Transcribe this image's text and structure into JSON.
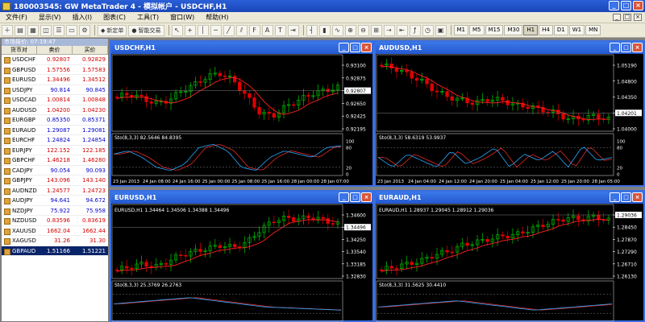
{
  "window": {
    "title": "180003545: GW MetaTrader 4 - 模拟帐户 - USDCHF,H1",
    "min": "_",
    "max": "□",
    "close": "×"
  },
  "menu": {
    "items": [
      "文件(F)",
      "显示(V)",
      "插入(I)",
      "图表(C)",
      "工具(T)",
      "窗口(W)",
      "帮助(H)"
    ],
    "mdi": [
      "_",
      "□",
      "×"
    ]
  },
  "toolbar": {
    "new_order": "新定单",
    "auto_trading": "智能交易",
    "timeframes": [
      "M1",
      "M5",
      "M15",
      "M30",
      "H1",
      "H4",
      "D1",
      "W1",
      "MN"
    ],
    "active_timeframe": "H1"
  },
  "market_watch": {
    "title": "市场报价: 07:19:47",
    "headers": [
      "货币对",
      "卖价",
      "买价"
    ],
    "rows": [
      {
        "symbol": "USDCHF",
        "bid": "0.92807",
        "ask": "0.92829",
        "dir": "down"
      },
      {
        "symbol": "GBPUSD",
        "bid": "1.57556",
        "ask": "1.57583",
        "dir": "down"
      },
      {
        "symbol": "EURUSD",
        "bid": "1.34496",
        "ask": "1.34512",
        "dir": "down"
      },
      {
        "symbol": "USDJPY",
        "bid": "90.814",
        "ask": "90.845",
        "dir": "up"
      },
      {
        "symbol": "USDCAD",
        "bid": "1.00814",
        "ask": "1.00848",
        "dir": "down"
      },
      {
        "symbol": "AUDUSD",
        "bid": "1.04200",
        "ask": "1.04230",
        "dir": "down"
      },
      {
        "symbol": "EURGBP",
        "bid": "0.85350",
        "ask": "0.85371",
        "dir": "up"
      },
      {
        "symbol": "EURAUD",
        "bid": "1.29087",
        "ask": "1.29081",
        "dir": "up"
      },
      {
        "symbol": "EURCHF",
        "bid": "1.24824",
        "ask": "1.24854",
        "dir": "up"
      },
      {
        "symbol": "EURJPY",
        "bid": "122.152",
        "ask": "122.185",
        "dir": "down"
      },
      {
        "symbol": "GBPCHF",
        "bid": "1.46218",
        "ask": "1.46280",
        "dir": "down"
      },
      {
        "symbol": "CADJPY",
        "bid": "90.054",
        "ask": "90.093",
        "dir": "up"
      },
      {
        "symbol": "GBPJPY",
        "bid": "143.096",
        "ask": "143.140",
        "dir": "down"
      },
      {
        "symbol": "AUDNZD",
        "bid": "1.24577",
        "ask": "1.24723",
        "dir": "down"
      },
      {
        "symbol": "AUDJPY",
        "bid": "94.641",
        "ask": "94.672",
        "dir": "up"
      },
      {
        "symbol": "NZDJPY",
        "bid": "75.922",
        "ask": "75.958",
        "dir": "up"
      },
      {
        "symbol": "NZDUSD",
        "bid": "0.83596",
        "ask": "0.83619",
        "dir": "down"
      },
      {
        "symbol": "XAUUSD",
        "bid": "1662.04",
        "ask": "1662.44",
        "dir": "down"
      },
      {
        "symbol": "XAGUSD",
        "bid": "31.26",
        "ask": "31.30",
        "dir": "down"
      },
      {
        "symbol": "GBPAUD",
        "bid": "1.51166",
        "ask": "1.51221",
        "dir": "sel"
      }
    ]
  },
  "colors": {
    "bull": "#00c800",
    "bear": "#e00000",
    "ma": "#ff2020",
    "stoch_main": "#2aa8ff",
    "stoch_signal": "#ff3030",
    "grid": "#404040",
    "axis_text": "#ffffff",
    "price_line": "#808080"
  },
  "charts": [
    {
      "title": "USDCHF,H1",
      "prices": [
        "0.93100",
        "0.92875",
        "0.92807",
        "0.92650",
        "0.92425",
        "0.92195"
      ],
      "current": "0.92807",
      "stoch_label": "Sto(8,3,3) 82.5646 84.8395",
      "stoch_ticks": [
        "100",
        "80",
        "20",
        "0"
      ],
      "dates": [
        "23 Jan 2013",
        "24 Jan 08:00",
        "24 Jan 16:00",
        "25 Jan 00:00",
        "25 Jan 08:00",
        "25 Jan 16:00",
        "28 Jan 00:00",
        "28 Jan 07:00"
      ],
      "trend": [
        0.45,
        0.5,
        0.42,
        0.35,
        0.4,
        0.55,
        0.65,
        0.78,
        0.82,
        0.7,
        0.45,
        0.2,
        0.15,
        0.3,
        0.4,
        0.5,
        0.55,
        0.6
      ],
      "stoch": [
        0.6,
        0.7,
        0.5,
        0.2,
        0.1,
        0.3,
        0.8,
        0.9,
        0.7,
        0.2,
        0.1,
        0.5,
        0.7,
        0.6,
        0.5,
        0.8,
        0.85
      ]
    },
    {
      "title": "AUDUSD,H1",
      "prices": [
        "1.05190",
        "1.04800",
        "1.04350",
        "1.04201",
        "1.04000"
      ],
      "current": "1.04201",
      "stoch_label": "Sto(8,3,3) 58.6319 53.9937",
      "stoch_ticks": [
        "100",
        "80",
        "20",
        "0"
      ],
      "dates": [
        "23 Jan 2013",
        "24 Jan 04:00",
        "24 Jan 12:00",
        "24 Jan 20:00",
        "25 Jan 04:00",
        "25 Jan 12:00",
        "25 Jan 20:00",
        "28 Jan 05:00"
      ],
      "trend": [
        0.95,
        0.9,
        0.8,
        0.7,
        0.55,
        0.45,
        0.4,
        0.35,
        0.42,
        0.4,
        0.32,
        0.3,
        0.25,
        0.2,
        0.1,
        0.12,
        0.15,
        0.1
      ],
      "stoch": [
        0.5,
        0.2,
        0.6,
        0.4,
        0.2,
        0.7,
        0.3,
        0.5,
        0.8,
        0.2,
        0.6,
        0.4,
        0.7,
        0.2,
        0.85,
        0.4,
        0.5
      ]
    },
    {
      "title": "EURUSD,H1",
      "label": "EURUSD,H1  1.34464  1.34506  1.34388  1.34496",
      "prices": [
        "1.34600",
        "1.34496",
        "1.34250",
        "1.33540",
        "1.33185",
        "1.32830"
      ],
      "current": "1.34496",
      "stoch_label": "Sto(8,3,3) 25.3769 26.2763",
      "dates": [],
      "trend": [
        0.05,
        0.1,
        0.15,
        0.1,
        0.2,
        0.3,
        0.35,
        0.4,
        0.45,
        0.42,
        0.5,
        0.7,
        0.85,
        0.9,
        0.88,
        0.92,
        0.85,
        0.8
      ],
      "stoch": [
        0.5,
        0.7,
        0.4,
        0.3
      ]
    },
    {
      "title": "EURAUD,H1",
      "label": "EURAUD,H1  1.28937  1.29045  1.28912  1.29036",
      "prices": [
        "1.29036",
        "1.28450",
        "1.27870",
        "1.27290",
        "1.26710",
        "1.26130"
      ],
      "current": "1.29036",
      "stoch_label": "Sto(8,3,3) 31.5625 30.4410",
      "dates": [],
      "trend": [
        0.05,
        0.1,
        0.15,
        0.2,
        0.3,
        0.35,
        0.45,
        0.5,
        0.55,
        0.6,
        0.62,
        0.7,
        0.78,
        0.85,
        0.9,
        0.88,
        0.92,
        0.86
      ],
      "stoch": [
        0.4,
        0.6,
        0.3,
        0.5
      ]
    }
  ]
}
